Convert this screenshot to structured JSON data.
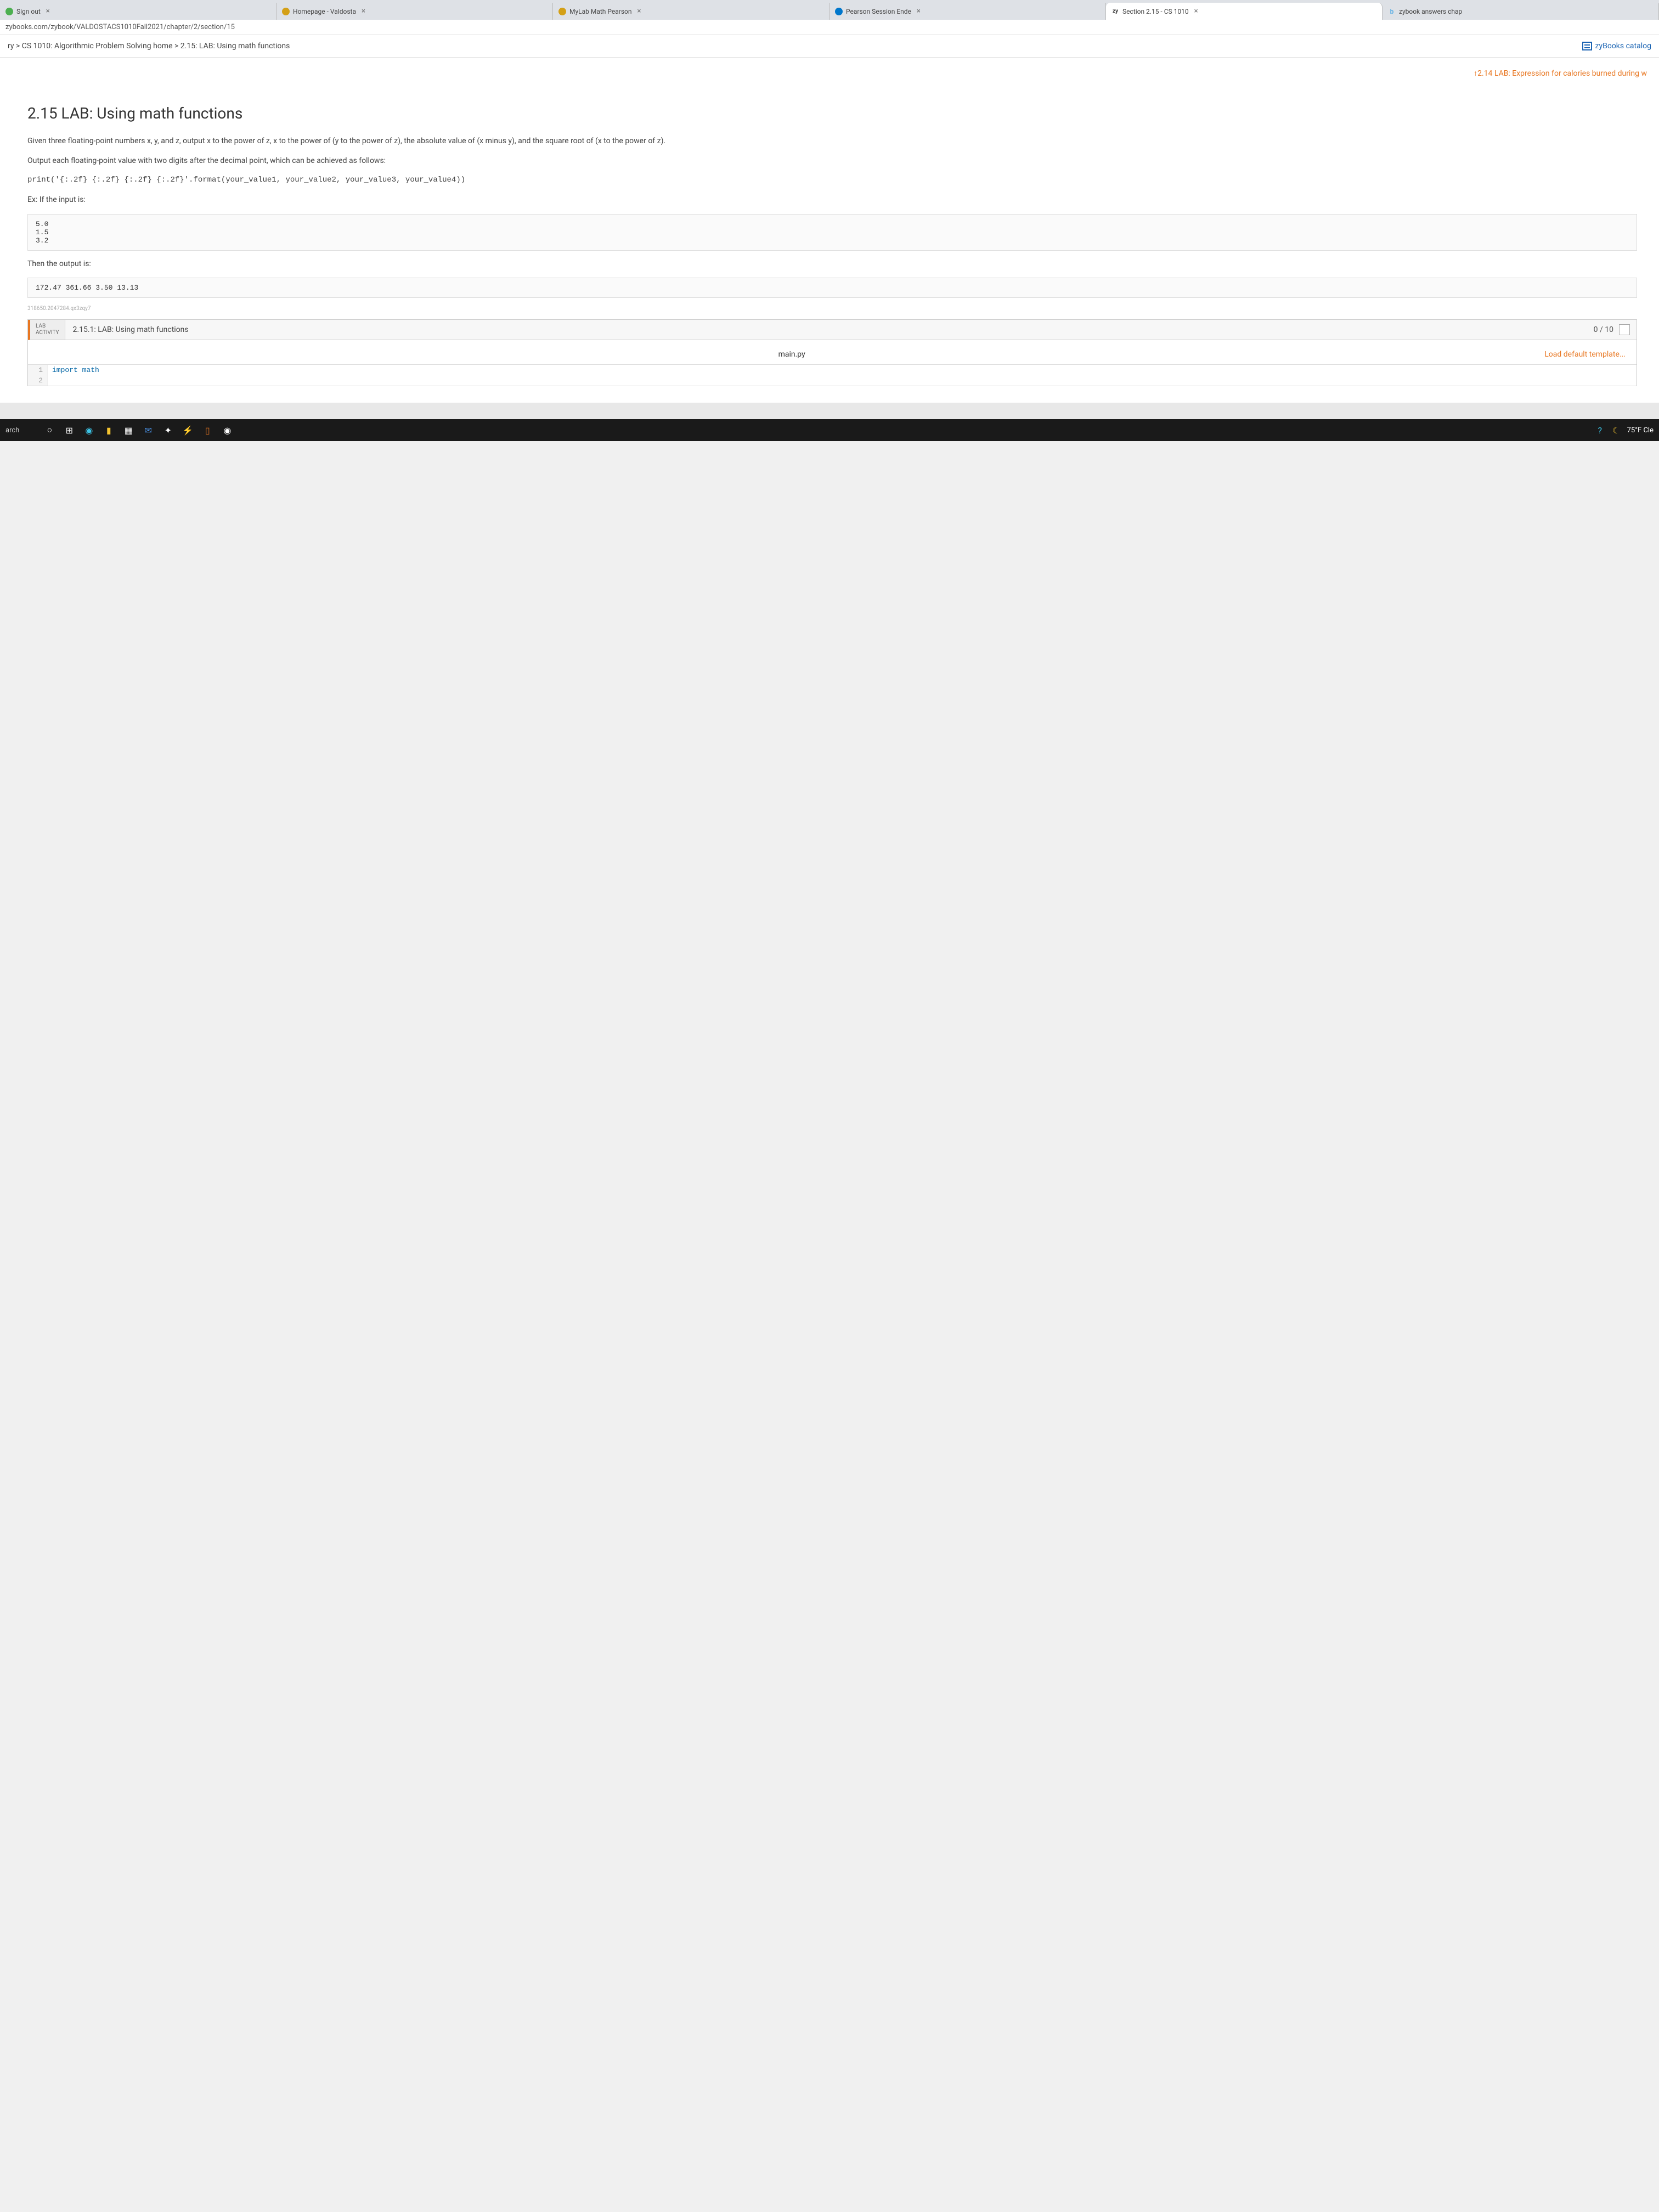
{
  "tabs": [
    {
      "label": "Sign out",
      "icon_color": "#4caf50"
    },
    {
      "label": "Homepage - Valdosta",
      "icon_color": "#d4a017"
    },
    {
      "label": "MyLab Math Pearson",
      "icon_color": "#d4a017"
    },
    {
      "label": "Pearson Session Ende",
      "icon_color": "#0077cc"
    },
    {
      "label": "Section 2.15 - CS 1010",
      "prefix": "zy",
      "active": true
    },
    {
      "label": "zybook answers chap",
      "icon_color": "#5eb0e5"
    }
  ],
  "url": "zybooks.com/zybook/VALDOSTACS1010Fall2021/chapter/2/section/15",
  "breadcrumb": "ry > CS 1010: Algorithmic Problem Solving home > 2.15: LAB: Using math functions",
  "catalog_link": "zyBooks catalog",
  "prev_link": "↑2.14 LAB: Expression for calories burned during w",
  "page_title": "2.15 LAB: Using math functions",
  "instructions": {
    "p1": "Given three floating-point numbers x, y, and z, output x to the power of z, x to the power of (y to the power of z), the absolute value of (x minus y), and the square root of (x to the power of z).",
    "p2": "Output each floating-point value with two digits after the decimal point, which can be achieved as follows:",
    "code_line": "print('{:.2f} {:.2f} {:.2f} {:.2f}'.format(your_value1, your_value2, your_value3, your_value4))",
    "p3": "Ex: If the input is:",
    "input_example": "5.0\n1.5\n3.2",
    "p4": "Then the output is:",
    "output_example": "172.47 361.66 3.50 13.13"
  },
  "tiny_id": "318650.2047284.qx3zqy7",
  "activity": {
    "tag_line1": "LAB",
    "tag_line2": "ACTIVITY",
    "title": "2.15.1: LAB: Using math functions",
    "score": "0 / 10",
    "filename": "main.py",
    "load_template": "Load default template...",
    "code": [
      {
        "n": "1",
        "text": "import math"
      },
      {
        "n": "2",
        "text": ""
      }
    ]
  },
  "taskbar": {
    "search": "arch",
    "weather": "75°F Cle"
  }
}
